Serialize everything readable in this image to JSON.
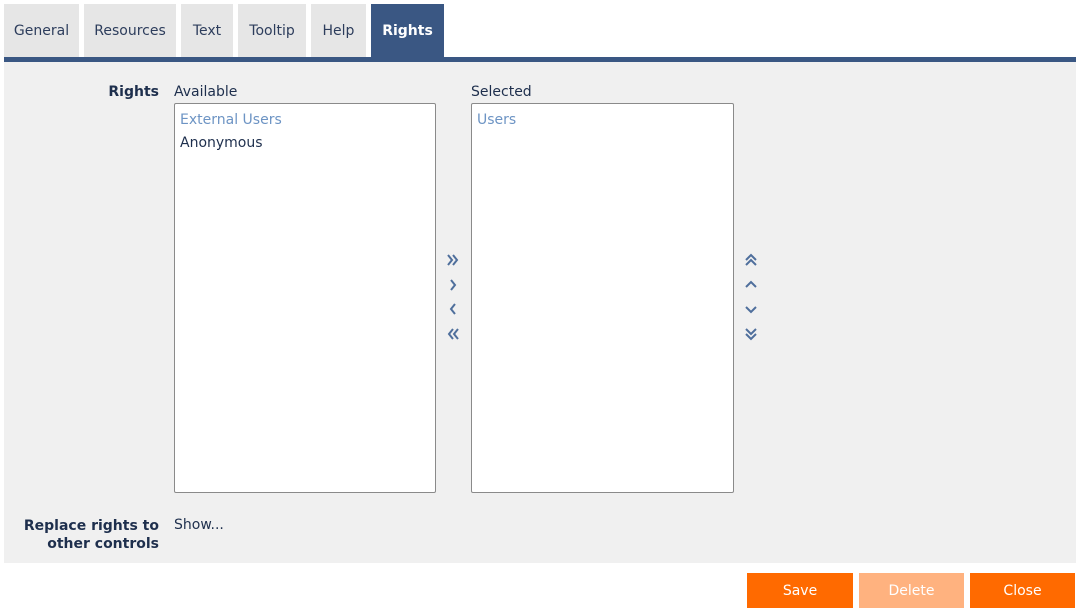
{
  "tabs": [
    {
      "label": "General"
    },
    {
      "label": "Resources"
    },
    {
      "label": "Text"
    },
    {
      "label": "Tooltip"
    },
    {
      "label": "Help"
    },
    {
      "label": "Rights",
      "active": true
    }
  ],
  "rights": {
    "label": "Rights",
    "available_label": "Available",
    "selected_label": "Selected",
    "available": [
      {
        "label": "External Users",
        "selected": true
      },
      {
        "label": "Anonymous"
      }
    ],
    "selected": [
      {
        "label": "Users",
        "selected": true
      }
    ]
  },
  "transfer_icons": [
    "double-chevron-right-icon",
    "chevron-right-icon",
    "chevron-left-icon",
    "double-chevron-left-icon"
  ],
  "order_icons": [
    "double-chevron-up-icon",
    "chevron-up-icon",
    "chevron-down-icon",
    "double-chevron-down-icon"
  ],
  "replace": {
    "label_line1": "Replace rights to",
    "label_line2": "other controls",
    "link": "Show..."
  },
  "buttons": {
    "save": "Save",
    "delete": "Delete",
    "close": "Close"
  },
  "colors": {
    "accent": "#3a5783",
    "button": "#ff6a00",
    "button_disabled": "#ffb27f",
    "selected_item": "#6d94c4"
  }
}
